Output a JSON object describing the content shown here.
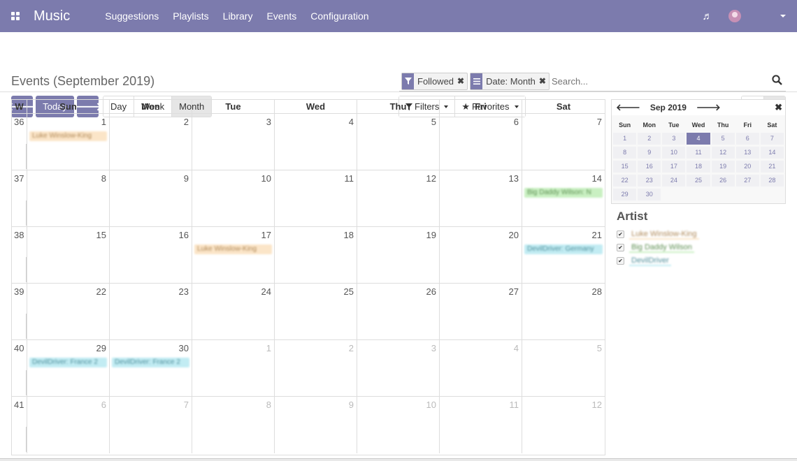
{
  "nav": {
    "app_name": "Music",
    "menu": [
      "Suggestions",
      "Playlists",
      "Library",
      "Events",
      "Configuration"
    ]
  },
  "control": {
    "title": "Events (September 2019)",
    "today_label": "Today",
    "prev_icon": "arrow-left-icon",
    "next_icon": "arrow-right-icon",
    "scales": [
      "Day",
      "Week",
      "Month"
    ],
    "active_scale": "Month",
    "filters_label": "Filters",
    "favorites_label": "Favorites",
    "search_placeholder": "Search...",
    "facets": [
      {
        "icon": "filter-icon",
        "label": "Followed"
      },
      {
        "icon": "group-by-icon",
        "label": "Date: Month"
      }
    ]
  },
  "calendar": {
    "week_col": "W",
    "weekdays": [
      "Sun",
      "Mon",
      "Tue",
      "Wed",
      "Thu",
      "Fri",
      "Sat"
    ],
    "weeks": [
      {
        "num": "36",
        "days": [
          {
            "d": "1",
            "ev": "Luke Winslow-King",
            "c": "orange"
          },
          {
            "d": "2"
          },
          {
            "d": "3"
          },
          {
            "d": "4"
          },
          {
            "d": "5"
          },
          {
            "d": "6"
          },
          {
            "d": "7"
          }
        ]
      },
      {
        "num": "37",
        "days": [
          {
            "d": "8"
          },
          {
            "d": "9"
          },
          {
            "d": "10"
          },
          {
            "d": "11"
          },
          {
            "d": "12"
          },
          {
            "d": "13"
          },
          {
            "d": "14",
            "ev": "Big Daddy Wilson: N",
            "c": "green"
          }
        ]
      },
      {
        "num": "38",
        "days": [
          {
            "d": "15"
          },
          {
            "d": "16"
          },
          {
            "d": "17",
            "ev": "Luke Winslow-King",
            "c": "orange"
          },
          {
            "d": "18"
          },
          {
            "d": "19"
          },
          {
            "d": "20"
          },
          {
            "d": "21",
            "ev": "DevilDriver: Germany",
            "c": "blue"
          }
        ]
      },
      {
        "num": "39",
        "days": [
          {
            "d": "22"
          },
          {
            "d": "23"
          },
          {
            "d": "24"
          },
          {
            "d": "25"
          },
          {
            "d": "26"
          },
          {
            "d": "27"
          },
          {
            "d": "28"
          }
        ]
      },
      {
        "num": "40",
        "days": [
          {
            "d": "29",
            "ev": "DevilDriver: France 2",
            "c": "blue"
          },
          {
            "d": "30",
            "ev": "DevilDriver: France 2",
            "c": "blue"
          },
          {
            "d": "1",
            "o": true
          },
          {
            "d": "2",
            "o": true
          },
          {
            "d": "3",
            "o": true
          },
          {
            "d": "4",
            "o": true
          },
          {
            "d": "5",
            "o": true
          }
        ]
      },
      {
        "num": "41",
        "days": [
          {
            "d": "6",
            "o": true
          },
          {
            "d": "7",
            "o": true
          },
          {
            "d": "8",
            "o": true
          },
          {
            "d": "9",
            "o": true
          },
          {
            "d": "10",
            "o": true
          },
          {
            "d": "11",
            "o": true
          },
          {
            "d": "12",
            "o": true
          }
        ]
      }
    ]
  },
  "mini_calendar": {
    "month_label": "Sep 2019",
    "weekdays": [
      "Sun",
      "Mon",
      "Tue",
      "Wed",
      "Thu",
      "Fri",
      "Sat"
    ],
    "days": [
      "1",
      "2",
      "3",
      "4",
      "5",
      "6",
      "7",
      "8",
      "9",
      "10",
      "11",
      "12",
      "13",
      "14",
      "15",
      "16",
      "17",
      "18",
      "19",
      "20",
      "21",
      "22",
      "23",
      "24",
      "25",
      "26",
      "27",
      "28",
      "29",
      "30"
    ],
    "selected": "4"
  },
  "artist_filter": {
    "title": "Artist",
    "items": [
      {
        "name": "Luke Winslow-King",
        "c": "o"
      },
      {
        "name": "Big Daddy Wilson",
        "c": "g"
      },
      {
        "name": "DevilDriver",
        "c": "b"
      }
    ]
  }
}
